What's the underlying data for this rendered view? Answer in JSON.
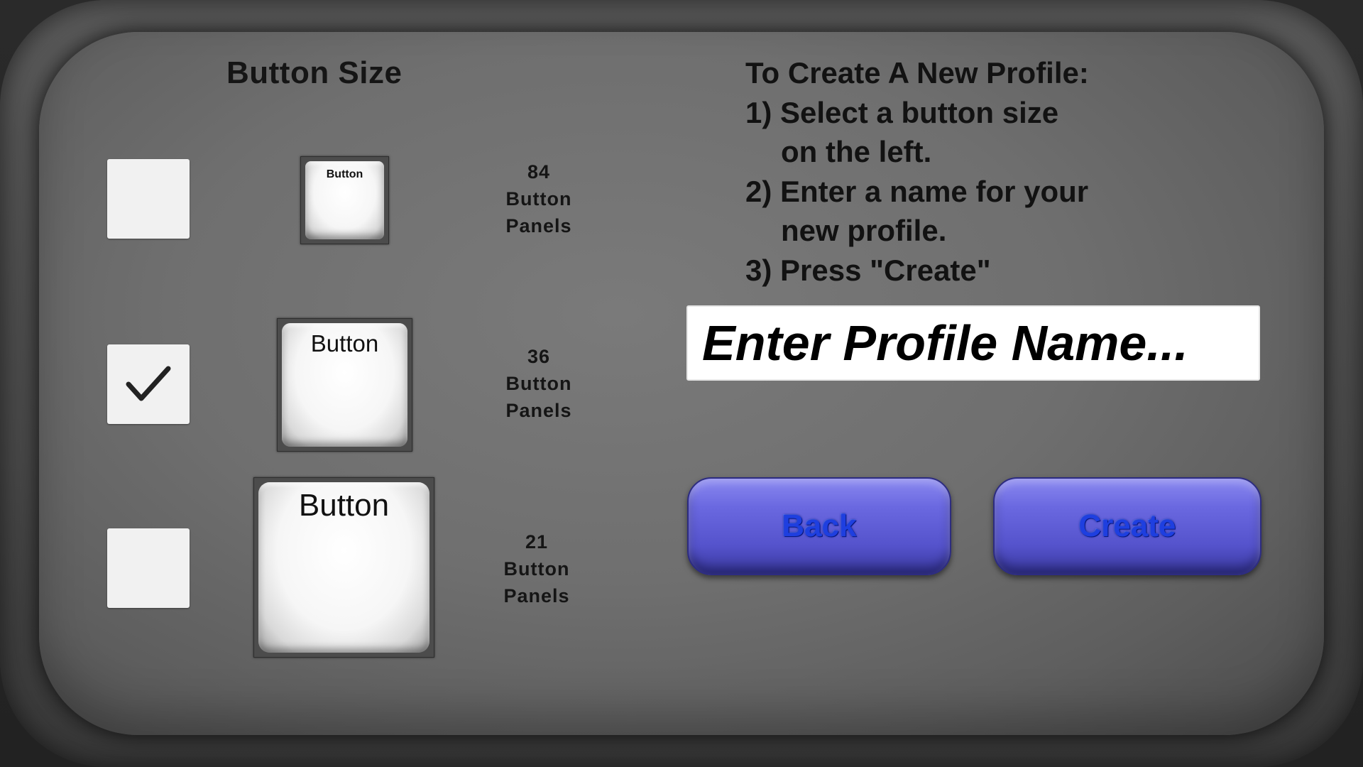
{
  "left": {
    "title": "Button Size",
    "options": [
      {
        "preview_label": "Button",
        "count": "84",
        "line2": "Button",
        "line3": "Panels",
        "checked": false
      },
      {
        "preview_label": "Button",
        "count": "36",
        "line2": "Button",
        "line3": "Panels",
        "checked": true
      },
      {
        "preview_label": "Button",
        "count": "21",
        "line2": "Button",
        "line3": "Panels",
        "checked": false
      }
    ]
  },
  "instructions": {
    "heading": "To Create A New Profile:",
    "step1a": "1) Select a button size",
    "step1b": "on the left.",
    "step2a": "2) Enter a name for your",
    "step2b": "new profile.",
    "step3": "3) Press \"Create\""
  },
  "profile_input": {
    "placeholder": "Enter Profile Name...",
    "value": ""
  },
  "buttons": {
    "back_label": "Back",
    "create_label": "Create"
  },
  "colors": {
    "button_blue": "#5f5de0",
    "button_text_blue": "#1e3fe0",
    "checkbox_bg": "#f1f1f1"
  }
}
